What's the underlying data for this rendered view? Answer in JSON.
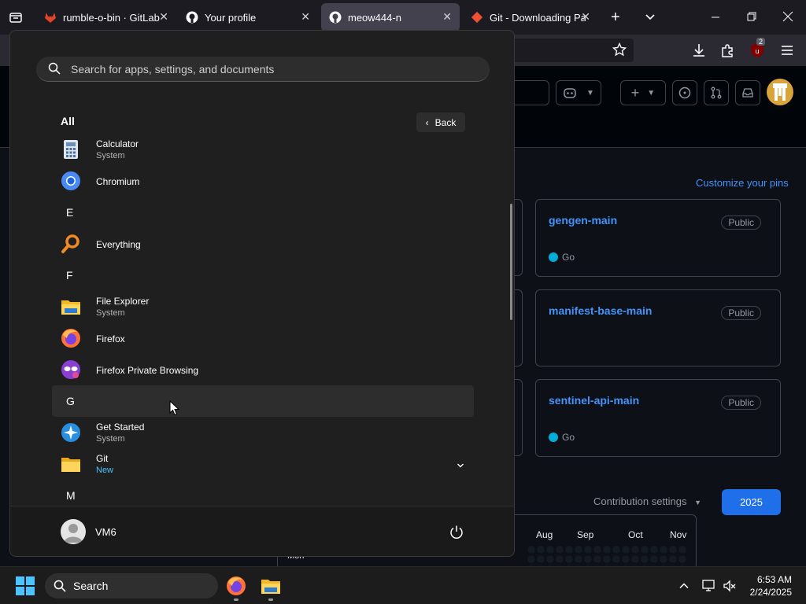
{
  "browser": {
    "tabs": [
      {
        "title": "rumble-o-bin · GitLab",
        "favicon": "gitlab-icon"
      },
      {
        "title": "Your profile",
        "favicon": "github-icon"
      },
      {
        "title": "meow444-n",
        "favicon": "github-icon",
        "active": true
      },
      {
        "title": "Git - Downloading Pack",
        "favicon": "git-icon"
      }
    ],
    "extension_badge": "2"
  },
  "github": {
    "customize_pins": "Customize your pins",
    "pins": [
      {
        "name": "gengen-main",
        "visibility": "Public",
        "language": "Go"
      },
      {
        "name": "manifest-base-main",
        "visibility": "Public",
        "language": ""
      },
      {
        "name": "sentinel-api-main",
        "visibility": "Public",
        "language": "Go"
      }
    ],
    "contribution_settings": "Contribution settings",
    "year": "2025",
    "months": [
      "Aug",
      "Sep",
      "Oct",
      "Nov"
    ],
    "weekday_label": "Mon"
  },
  "start_menu": {
    "search_placeholder": "Search for apps, settings, and documents",
    "all_label": "All",
    "back_label": "Back",
    "items": {
      "calculator": {
        "name": "Calculator",
        "sub": "System"
      },
      "chromium": {
        "name": "Chromium"
      },
      "letter_e": "E",
      "everything": {
        "name": "Everything"
      },
      "letter_f": "F",
      "file_explorer": {
        "name": "File Explorer",
        "sub": "System"
      },
      "firefox": {
        "name": "Firefox"
      },
      "firefox_private": {
        "name": "Firefox Private Browsing"
      },
      "letter_g": "G",
      "get_started": {
        "name": "Get Started",
        "sub": "System"
      },
      "git": {
        "name": "Git",
        "badge": "New"
      },
      "letter_m": "M"
    },
    "user_name": "VM6"
  },
  "taskbar": {
    "search_label": "Search",
    "time": "6:53 AM",
    "date": "2/24/2025"
  },
  "colors": {
    "accent_blue": "#4493f8",
    "go_lang": "#00ADD8",
    "year_button": "#1f6feb",
    "new_badge": "#4cc2ff"
  }
}
